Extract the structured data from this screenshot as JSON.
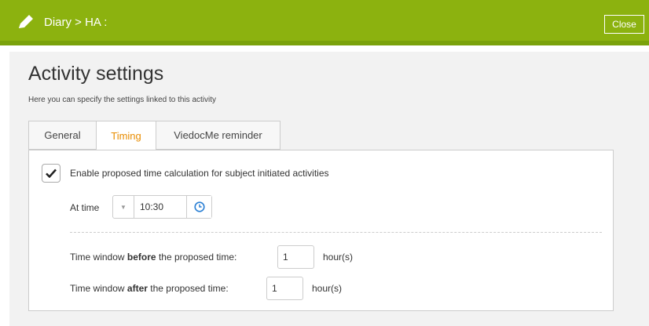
{
  "header": {
    "title": "Diary > HA :",
    "close_label": "Close",
    "edit_icon": "pencil-icon"
  },
  "page": {
    "title": "Activity settings",
    "subtitle": "Here you can specify the settings linked to this activity"
  },
  "tabs": [
    {
      "label": "General",
      "active": false
    },
    {
      "label": "Timing",
      "active": true
    },
    {
      "label": "ViedocMe reminder",
      "active": false
    }
  ],
  "timing": {
    "enable_checked": true,
    "enable_label": "Enable proposed time calculation for subject initiated activities",
    "at_time_label": "At time",
    "time_value": "10:30",
    "clock_icon": "clock-icon",
    "before": {
      "prefix": "Time window ",
      "emphasis": "before",
      "suffix": " the proposed time:",
      "value": "1",
      "unit": "hour(s)"
    },
    "after": {
      "prefix": "Time window ",
      "emphasis": "after",
      "suffix": " the proposed time:",
      "value": "1",
      "unit": "hour(s)"
    }
  },
  "colors": {
    "header": "#8cb20f",
    "active_tab": "#e88c00",
    "clock": "#2a7fd4"
  }
}
